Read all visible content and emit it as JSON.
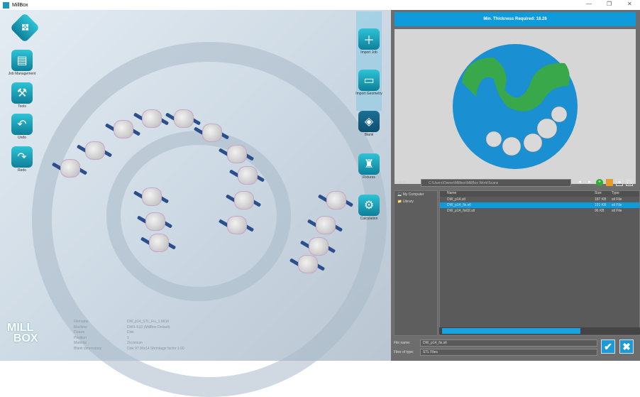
{
  "window": {
    "title": "MillBox",
    "minimize": "—",
    "maximize": "❐",
    "close": "✕"
  },
  "left_toolbar": [
    {
      "label": "",
      "icon": "navigation-pad-icon"
    },
    {
      "label": "Job Management",
      "icon": "document-icon"
    },
    {
      "label": "Tools",
      "icon": "tools-icon"
    },
    {
      "label": "Undo",
      "icon": "undo-icon"
    },
    {
      "label": "Redo",
      "icon": "redo-icon"
    }
  ],
  "right_toolbar": [
    {
      "label": "Import Job",
      "icon": "add-file-icon"
    },
    {
      "label": "Import Geometry",
      "icon": "geometry-icon"
    },
    {
      "label": "Blank",
      "icon": "blank-icon"
    },
    {
      "label": "Fixtures",
      "icon": "fixture-icon"
    },
    {
      "label": "Calculation",
      "icon": "calculate-icon"
    }
  ],
  "info": [
    {
      "key": "Filename",
      "value": "DW_p14_STL_Fix_1.MLW"
    },
    {
      "key": "Machine",
      "value": "DWX-51D (MillBox Default)"
    },
    {
      "key": "Fixture",
      "value": "Disk"
    },
    {
      "key": "Position",
      "value": "1"
    },
    {
      "key": "Material",
      "value": "Zirconium"
    },
    {
      "key": "Blank dimensions",
      "value": "Disk 97.90x14 Shrinkage factor 1.00"
    }
  ],
  "logo": {
    "line1": "MILL",
    "line2": "BOX"
  },
  "preview": {
    "title": "Min. Thickness Required: 18.26",
    "colors": {
      "disk": "#1a8fd2",
      "part": "#38a84b",
      "blank": "#d9d9d9"
    }
  },
  "file_dialog": {
    "look_in_label": "Look in:",
    "path": "C:\\Users\\Owner\\Millbox\\MillBox Work\\Scans",
    "tree": [
      "My Computer",
      "Library"
    ],
    "columns": [
      "Name",
      "Size",
      "Type"
    ],
    "files": [
      {
        "name": "DW_p14.stl",
        "size": "187 KB",
        "type": "stl File",
        "selected": false
      },
      {
        "name": "DW_p14_fix.stl",
        "size": "191 KB",
        "type": "stl File",
        "selected": true
      },
      {
        "name": "DW_p14_fix02.stl",
        "size": "96 KB",
        "type": "stl File",
        "selected": false
      }
    ],
    "file_name_label": "File name:",
    "file_name": "DW_p14_fix.stl",
    "file_type_label": "Files of type:",
    "file_type": "STL Files",
    "ok": "✔",
    "cancel": "✖"
  }
}
